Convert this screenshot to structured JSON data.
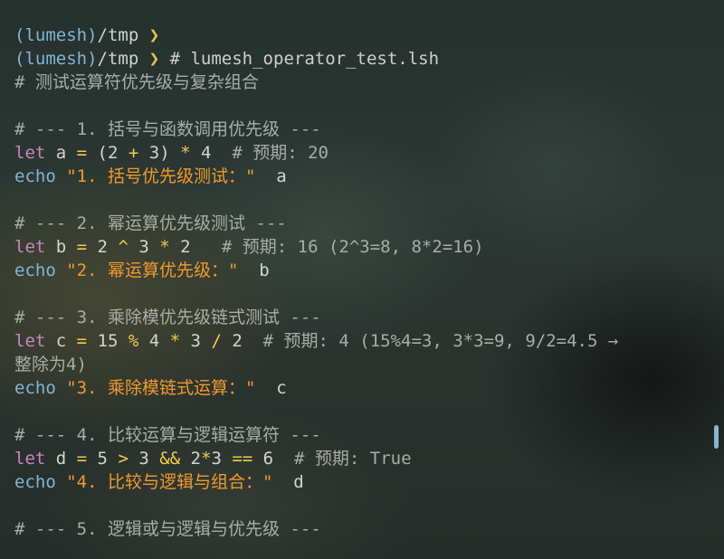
{
  "terminal": {
    "lines": [
      [
        {
          "t": "(lumesh)",
          "c": "c-path"
        },
        {
          "t": "/tmp ",
          "c": "c-plain"
        },
        {
          "t": "❯",
          "c": "c-arrow"
        }
      ],
      [
        {
          "t": "(lumesh)",
          "c": "c-path"
        },
        {
          "t": "/tmp ",
          "c": "c-plain"
        },
        {
          "t": "❯",
          "c": "c-arrow"
        },
        {
          "t": " # lumesh_operator_test.lsh",
          "c": "c-cmd"
        }
      ],
      [
        {
          "t": "# 测试运算符优先级与复杂组合",
          "c": "c-comment"
        }
      ],
      [],
      [
        {
          "t": "# --- 1. 括号与函数调用优先级 ---",
          "c": "c-comment"
        }
      ],
      [
        {
          "t": "let",
          "c": "c-kw"
        },
        {
          "t": " a ",
          "c": "c-var"
        },
        {
          "t": "=",
          "c": "c-op"
        },
        {
          "t": " (2 ",
          "c": "c-num"
        },
        {
          "t": "+",
          "c": "c-op"
        },
        {
          "t": " 3) ",
          "c": "c-num"
        },
        {
          "t": "*",
          "c": "c-op"
        },
        {
          "t": " 4  ",
          "c": "c-num"
        },
        {
          "t": "# 预期: 20",
          "c": "c-comment"
        }
      ],
      [
        {
          "t": "echo",
          "c": "c-echo"
        },
        {
          "t": " \"1. 括号优先级测试：\"",
          "c": "c-str"
        },
        {
          "t": "  a",
          "c": "c-var"
        }
      ],
      [],
      [
        {
          "t": "# --- 2. 幂运算优先级测试 ---",
          "c": "c-comment"
        }
      ],
      [
        {
          "t": "let",
          "c": "c-kw"
        },
        {
          "t": " b ",
          "c": "c-var"
        },
        {
          "t": "=",
          "c": "c-op"
        },
        {
          "t": " 2 ",
          "c": "c-num"
        },
        {
          "t": "^",
          "c": "c-op"
        },
        {
          "t": " 3 ",
          "c": "c-num"
        },
        {
          "t": "*",
          "c": "c-op"
        },
        {
          "t": " 2   ",
          "c": "c-num"
        },
        {
          "t": "# 预期: 16 (2^3=8, 8*2=16)",
          "c": "c-comment"
        }
      ],
      [
        {
          "t": "echo",
          "c": "c-echo"
        },
        {
          "t": " \"2. 幂运算优先级：\"",
          "c": "c-str"
        },
        {
          "t": "  b",
          "c": "c-var"
        }
      ],
      [],
      [
        {
          "t": "# --- 3. 乘除模优先级链式测试 ---",
          "c": "c-comment"
        }
      ],
      [
        {
          "t": "let",
          "c": "c-kw"
        },
        {
          "t": " c ",
          "c": "c-var"
        },
        {
          "t": "=",
          "c": "c-op"
        },
        {
          "t": " 15 ",
          "c": "c-num"
        },
        {
          "t": "%",
          "c": "c-op"
        },
        {
          "t": " 4 ",
          "c": "c-num"
        },
        {
          "t": "*",
          "c": "c-op"
        },
        {
          "t": " 3 ",
          "c": "c-num"
        },
        {
          "t": "/",
          "c": "c-op"
        },
        {
          "t": " 2  ",
          "c": "c-num"
        },
        {
          "t": "# 预期: 4 (15%4=3, 3*3=9, 9/2=4.5 →",
          "c": "c-comment"
        }
      ],
      [
        {
          "t": "整除为4)",
          "c": "c-comment"
        }
      ],
      [
        {
          "t": "echo",
          "c": "c-echo"
        },
        {
          "t": " \"3. 乘除模链式运算：\"",
          "c": "c-str"
        },
        {
          "t": "  c",
          "c": "c-var"
        }
      ],
      [],
      [
        {
          "t": "# --- 4. 比较运算与逻辑运算符 ---",
          "c": "c-comment"
        }
      ],
      [
        {
          "t": "let",
          "c": "c-kw"
        },
        {
          "t": " d ",
          "c": "c-var"
        },
        {
          "t": "=",
          "c": "c-op"
        },
        {
          "t": " 5 ",
          "c": "c-num"
        },
        {
          "t": ">",
          "c": "c-op"
        },
        {
          "t": " 3 ",
          "c": "c-num"
        },
        {
          "t": "&&",
          "c": "c-op"
        },
        {
          "t": " 2",
          "c": "c-num"
        },
        {
          "t": "*",
          "c": "c-op"
        },
        {
          "t": "3 ",
          "c": "c-num"
        },
        {
          "t": "==",
          "c": "c-op"
        },
        {
          "t": " 6  ",
          "c": "c-num"
        },
        {
          "t": "# 预期: True",
          "c": "c-comment"
        }
      ],
      [
        {
          "t": "echo",
          "c": "c-echo"
        },
        {
          "t": " \"4. 比较与逻辑与组合：\"",
          "c": "c-str"
        },
        {
          "t": "  d",
          "c": "c-var"
        }
      ],
      [],
      [
        {
          "t": "# --- 5. 逻辑或与逻辑与优先级 ---",
          "c": "c-comment"
        }
      ]
    ]
  },
  "colors": {
    "path": "#7fb6d6",
    "prompt_arrow": "#e8c44c",
    "keyword": "#c686c0",
    "operator": "#f0cc50",
    "string": "#f09a2e",
    "comment": "#a9aca8",
    "scrollbar": "#8ab4d4"
  }
}
